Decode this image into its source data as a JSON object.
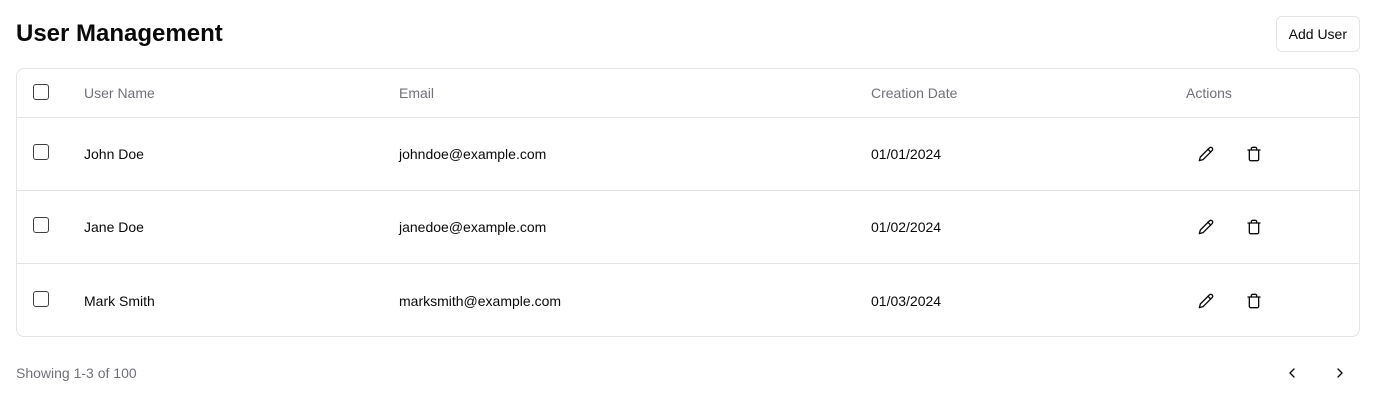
{
  "header": {
    "title": "User Management",
    "add_user_label": "Add User"
  },
  "table": {
    "columns": {
      "name": "User Name",
      "email": "Email",
      "date": "Creation Date",
      "actions": "Actions"
    },
    "rows": [
      {
        "name": "John Doe",
        "email": "johndoe@example.com",
        "date": "01/01/2024"
      },
      {
        "name": "Jane Doe",
        "email": "janedoe@example.com",
        "date": "01/02/2024"
      },
      {
        "name": "Mark Smith",
        "email": "marksmith@example.com",
        "date": "01/03/2024"
      }
    ],
    "row_actions": [
      "pencil-icon",
      "trash-icon"
    ]
  },
  "footer": {
    "showing": "Showing 1-3 of 100",
    "pager_icons": [
      "chevron-left-icon",
      "chevron-right-icon"
    ]
  },
  "colors": {
    "border": "#e4e4e7",
    "muted_text": "#71717a",
    "text": "#0a0a0a"
  }
}
